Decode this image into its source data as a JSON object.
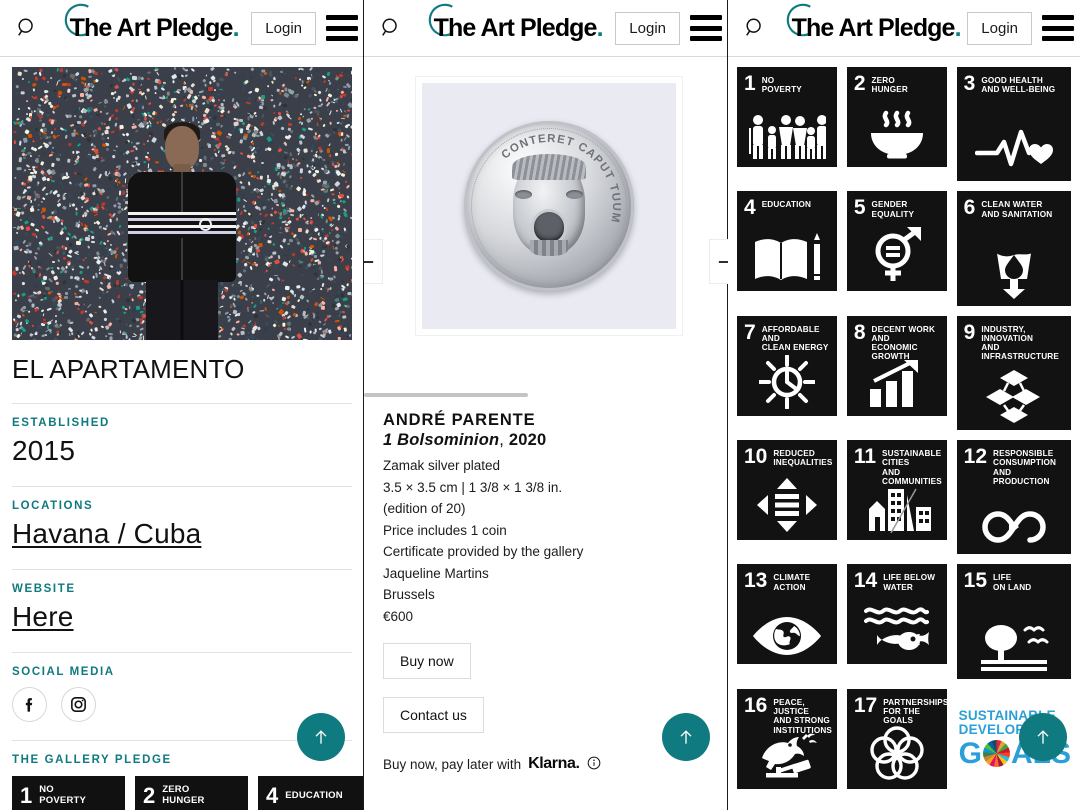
{
  "header": {
    "search_icon": "search-icon",
    "logo_text": "The Art Pledge",
    "logo_dot": ".",
    "login_label": "Login",
    "menu_icon": "hamburger-menu-icon"
  },
  "gallery_panel": {
    "image_alt": "gallery-portrait",
    "title": "EL APARTAMENTO",
    "sections": [
      {
        "label": "ESTABLISHED",
        "value": "2015",
        "link": false
      },
      {
        "label": "LOCATIONS",
        "value": "Havana / Cuba",
        "link": true
      },
      {
        "label": "WEBSITE",
        "value": "Here",
        "link": true
      }
    ],
    "social_label": "SOCIAL MEDIA",
    "social": [
      {
        "name": "facebook-icon",
        "glyph": "f"
      },
      {
        "name": "instagram-icon",
        "glyph": "o"
      }
    ],
    "pledge_label": "THE GALLERY PLEDGE",
    "pledge_goals": [
      {
        "num": "1",
        "line1": "NO",
        "line2": "POVERTY"
      },
      {
        "num": "2",
        "line1": "ZERO",
        "line2": "HUNGER"
      },
      {
        "num": "4",
        "line1": "EDUCATION",
        "line2": ""
      }
    ],
    "scroll_top_icon": "arrow-up-icon"
  },
  "artwork_panel": {
    "prev_label": "←",
    "next_label": "→",
    "coin_inscription": "CONTERET CAPUT TUUM",
    "scroll_thumb_pct": "45",
    "artist": "ANDRÉ PARENTE",
    "title": "1 Bolsominion",
    "year": "2020",
    "meta_lines": [
      "Zamak silver plated",
      "3.5 × 3.5 cm | 1 3/8 × 1 3/8 in.",
      "(edition of 20)",
      "Price includes 1 coin",
      "Certificate provided by the gallery",
      "Jaqueline Martins",
      "Brussels",
      "€600"
    ],
    "buy_label": "Buy now",
    "contact_label": "Contact us",
    "klarna_text": "Buy now, pay later with",
    "klarna_brand": "Klarna.",
    "klarna_info_icon": "info-icon",
    "scroll_top_icon": "arrow-up-icon"
  },
  "sdg_panel": {
    "goals": [
      {
        "num": "1",
        "label": "NO\nPOVERTY",
        "icon": "people-family-icon"
      },
      {
        "num": "2",
        "label": "ZERO\nHUNGER",
        "icon": "steaming-bowl-icon"
      },
      {
        "num": "3",
        "label": "GOOD HEALTH\nAND WELL-BEING",
        "icon": "heartbeat-icon"
      },
      {
        "num": "4",
        "label": "EDUCATION",
        "icon": "open-book-pencil-icon"
      },
      {
        "num": "5",
        "label": "GENDER\nEQUALITY",
        "icon": "gender-equality-icon"
      },
      {
        "num": "6",
        "label": "CLEAN WATER\nAND SANITATION",
        "icon": "water-glass-drop-icon"
      },
      {
        "num": "7",
        "label": "AFFORDABLE AND\nCLEAN ENERGY",
        "icon": "sun-power-icon"
      },
      {
        "num": "8",
        "label": "DECENT WORK AND\nECONOMIC GROWTH",
        "icon": "growth-chart-icon"
      },
      {
        "num": "9",
        "label": "INDUSTRY, INNOVATION\nAND INFRASTRUCTURE",
        "icon": "cubes-icon"
      },
      {
        "num": "10",
        "label": "REDUCED\nINEQUALITIES",
        "icon": "equal-arrows-icon"
      },
      {
        "num": "11",
        "label": "SUSTAINABLE CITIES\nAND COMMUNITIES",
        "icon": "city-buildings-icon"
      },
      {
        "num": "12",
        "label": "RESPONSIBLE\nCONSUMPTION\nAND PRODUCTION",
        "icon": "infinity-loop-icon"
      },
      {
        "num": "13",
        "label": "CLIMATE\nACTION",
        "icon": "eye-globe-icon"
      },
      {
        "num": "14",
        "label": "LIFE BELOW\nWATER",
        "icon": "fish-waves-icon"
      },
      {
        "num": "15",
        "label": "LIFE\nON LAND",
        "icon": "tree-birds-icon"
      },
      {
        "num": "16",
        "label": "PEACE, JUSTICE\nAND STRONG\nINSTITUTIONS",
        "icon": "dove-gavel-icon"
      },
      {
        "num": "17",
        "label": "PARTNERSHIPS\nFOR THE GOALS",
        "icon": "interlocking-circles-icon"
      }
    ],
    "logo": {
      "line1": "SUSTAINABLE",
      "line2": "DEVELOPMENT",
      "line3a": "G",
      "line3b": "ALS",
      "wheel_icon": "sdg-color-wheel-icon"
    },
    "scroll_top_icon": "arrow-up-icon"
  },
  "colors": {
    "accent_teal": "#0f7a7f",
    "tile_black": "#121212",
    "sdg_blue": "#2a9fd8"
  }
}
